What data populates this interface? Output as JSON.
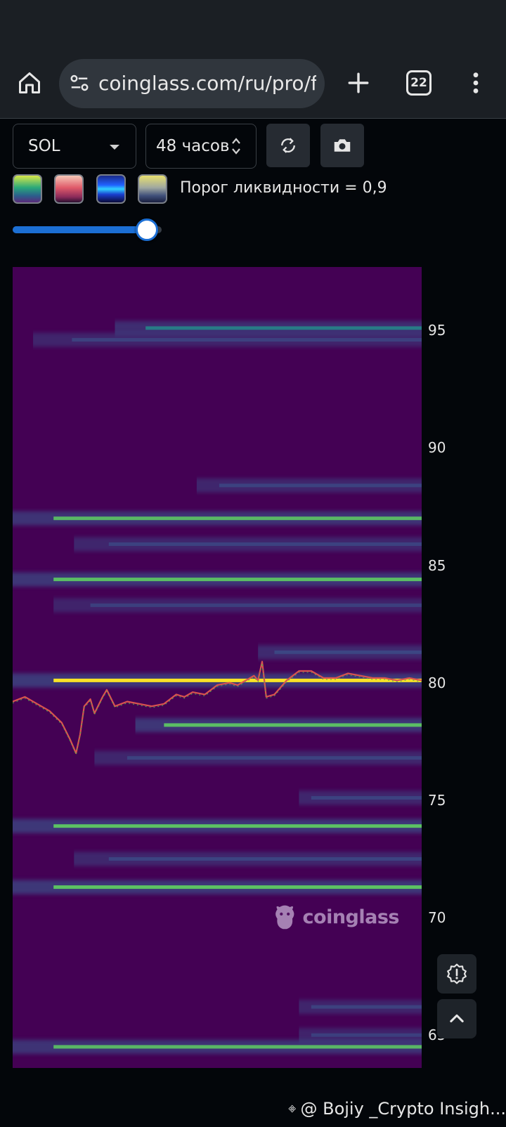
{
  "browser": {
    "url": "coinglass.com/ru/pro/fut",
    "tab_count": "22"
  },
  "controls": {
    "symbol": "SOL",
    "period": "48 часов",
    "threshold_label": "Порог ликвидности = 0,9",
    "threshold_value": 0.9
  },
  "color_schemes": [
    "viridis",
    "rose",
    "blue",
    "gold-slate"
  ],
  "chart_data": {
    "type": "heatmap",
    "title": "",
    "xlabel": "",
    "ylabel": "",
    "y_ticks": [
      "95",
      "90",
      "85",
      "80",
      "75",
      "70",
      "65"
    ],
    "ylim": [
      63.6,
      97.7
    ],
    "colors": {
      "background": "#440154",
      "low": "#3b528b",
      "mid": "#21918c",
      "high": "#5ec962",
      "max": "#fde725"
    },
    "liquidity_levels": [
      {
        "price": 95.1,
        "intensity": 0.55,
        "start": 0.25
      },
      {
        "price": 94.6,
        "intensity": 0.25,
        "start": 0.05
      },
      {
        "price": 88.4,
        "intensity": 0.3,
        "start": 0.45
      },
      {
        "price": 87.0,
        "intensity": 0.75,
        "start": 0.0
      },
      {
        "price": 85.9,
        "intensity": 0.3,
        "start": 0.15
      },
      {
        "price": 84.4,
        "intensity": 0.85,
        "start": 0.0
      },
      {
        "price": 83.3,
        "intensity": 0.2,
        "start": 0.1
      },
      {
        "price": 81.3,
        "intensity": 0.45,
        "start": 0.6
      },
      {
        "price": 80.1,
        "intensity": 0.95,
        "start": 0.0
      },
      {
        "price": 78.2,
        "intensity": 0.85,
        "start": 0.3
      },
      {
        "price": 76.8,
        "intensity": 0.3,
        "start": 0.2
      },
      {
        "price": 75.1,
        "intensity": 0.3,
        "start": 0.7
      },
      {
        "price": 73.9,
        "intensity": 0.9,
        "start": 0.0
      },
      {
        "price": 72.5,
        "intensity": 0.35,
        "start": 0.15
      },
      {
        "price": 71.3,
        "intensity": 0.9,
        "start": 0.0
      },
      {
        "price": 66.2,
        "intensity": 0.25,
        "start": 0.7
      },
      {
        "price": 65.0,
        "intensity": 0.2,
        "start": 0.7
      },
      {
        "price": 64.5,
        "intensity": 0.75,
        "start": 0.0
      }
    ],
    "price_series": {
      "name": "",
      "t": [
        0,
        0.03,
        0.06,
        0.09,
        0.12,
        0.14,
        0.155,
        0.165,
        0.175,
        0.19,
        0.2,
        0.22,
        0.23,
        0.25,
        0.28,
        0.31,
        0.34,
        0.37,
        0.4,
        0.42,
        0.44,
        0.47,
        0.5,
        0.53,
        0.55,
        0.57,
        0.59,
        0.6,
        0.61,
        0.62,
        0.64,
        0.67,
        0.7,
        0.73,
        0.76,
        0.79,
        0.82,
        0.85,
        0.88,
        0.91,
        0.94,
        0.97,
        1.0
      ],
      "y": [
        79.2,
        79.4,
        79.1,
        78.8,
        78.3,
        77.6,
        77.0,
        77.8,
        79.0,
        79.3,
        78.7,
        79.4,
        79.7,
        79.0,
        79.2,
        79.1,
        79.0,
        79.1,
        79.5,
        79.4,
        79.6,
        79.5,
        79.9,
        80.0,
        79.9,
        80.1,
        80.3,
        80.1,
        80.9,
        79.4,
        79.5,
        80.1,
        80.5,
        80.5,
        80.2,
        80.2,
        80.4,
        80.3,
        80.2,
        80.2,
        80.1,
        80.2,
        80.1
      ]
    }
  },
  "watermark": "coinglass",
  "footer": {
    "credit": "@ Bojiy _Crypto Insigh..."
  }
}
